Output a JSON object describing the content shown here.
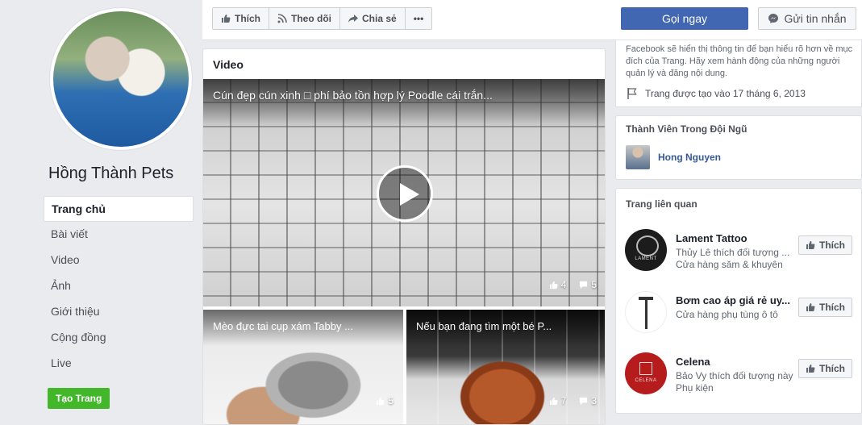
{
  "page": {
    "name": "Hồng Thành Pets",
    "nav": [
      {
        "label": "Trang chủ",
        "active": true
      },
      {
        "label": "Bài viết"
      },
      {
        "label": "Video"
      },
      {
        "label": "Ảnh"
      },
      {
        "label": "Giới thiệu"
      },
      {
        "label": "Cộng đồng"
      },
      {
        "label": "Live"
      }
    ],
    "create_page_label": "Tạo Trang"
  },
  "actions": {
    "like_label": "Thích",
    "follow_label": "Theo dõi",
    "share_label": "Chia sẻ",
    "more_label": "•••",
    "call_label": "Gọi ngay",
    "message_label": "Gửi tin nhắn"
  },
  "video_section": {
    "heading": "Video",
    "main": {
      "title": "Cún đẹp cún xinh □ phí bảo tồn hợp lý Poodle cái trắn...",
      "likes": "4",
      "comments": "5"
    },
    "thumbs": [
      {
        "title": "Mèo đực tai cụp xám Tabby ...",
        "likes": "5",
        "comments": ""
      },
      {
        "title": "Nếu bạn đang tìm một bé P...",
        "likes": "7",
        "comments": "3"
      }
    ]
  },
  "about": {
    "text": "Facebook sẽ hiển thị thông tin để bạn hiểu rõ hơn về mục đích của Trang. Hãy xem hành động của những người quản lý và đăng nội dung.",
    "created": "Trang được tạo vào 17 tháng 6, 2013"
  },
  "team": {
    "heading": "Thành Viên Trong Đội Ngũ",
    "members": [
      {
        "name": "Hong Nguyen"
      }
    ]
  },
  "related": {
    "heading": "Trang liên quan",
    "like_label": "Thích",
    "items": [
      {
        "name": "Lament Tattoo",
        "line1": "Thủy Lê thích đối tượng ...",
        "line2": "Cửa hàng săm & khuyên"
      },
      {
        "name": "Bơm cao áp giá rẻ uy...",
        "line1": "Cửa hàng phụ tùng ô tô",
        "line2": ""
      },
      {
        "name": "Celena",
        "line1": "Bảo Vy thích đối tượng này",
        "line2": "Phụ kiện"
      }
    ]
  },
  "colors": {
    "primary": "#4267b2",
    "green": "#42b72a",
    "link": "#365899",
    "background": "#e9ebee"
  }
}
